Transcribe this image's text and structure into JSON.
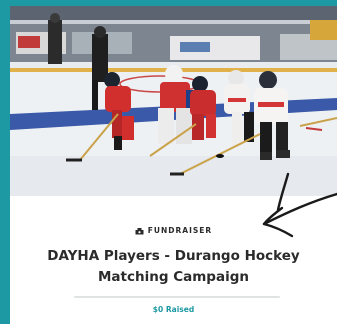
{
  "campaign": {
    "category": "FUNDRAISER",
    "category_icon": "fundraiser-icon",
    "title_line1": "DAYHA Players - Durango Hockey",
    "title_line2": "Matching Campaign",
    "raised_amount": "$0",
    "raised_label": "Raised",
    "progress_fraction": 0
  },
  "photo": {
    "description_icon": "hockey-photo"
  },
  "colors": {
    "accent": "#1d99a3",
    "title_text": "#2b2b2b"
  }
}
